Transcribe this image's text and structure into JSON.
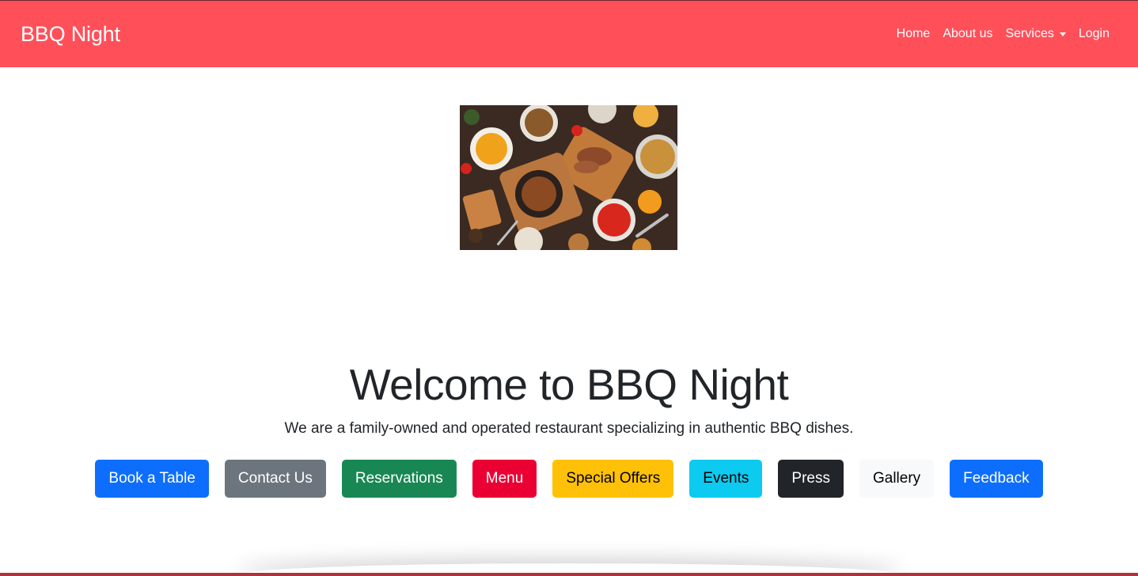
{
  "navbar": {
    "brand": "BBQ Night",
    "links": [
      {
        "label": "Home"
      },
      {
        "label": "About us"
      },
      {
        "label": "Services"
      },
      {
        "label": "Login"
      }
    ],
    "background_color": "#ff505a"
  },
  "hero": {
    "image_icon": "food-platter-image"
  },
  "welcome": {
    "title": "Welcome to BBQ Night",
    "subtitle": "We are a family-owned and operated restaurant specializing in authentic BBQ dishes."
  },
  "actions": [
    {
      "label": "Book a Table",
      "color": "#0d6efd"
    },
    {
      "label": "Contact Us",
      "color": "#6c757d"
    },
    {
      "label": "Reservations",
      "color": "#198754"
    },
    {
      "label": "Menu",
      "color": "#ea0033"
    },
    {
      "label": "Special Offers",
      "color": "#ffc107"
    },
    {
      "label": "Events",
      "color": "#0dcaf0"
    },
    {
      "label": "Press",
      "color": "#212529"
    },
    {
      "label": "Gallery",
      "color": "#f8f9fa"
    },
    {
      "label": "Feedback",
      "color": "#0d6efd"
    }
  ]
}
